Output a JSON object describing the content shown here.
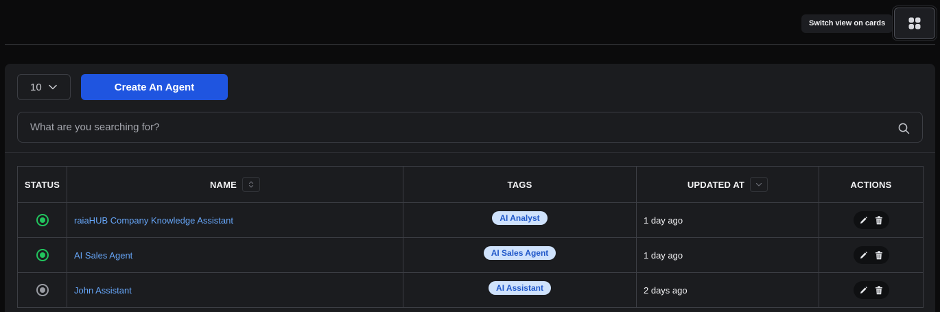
{
  "header": {
    "tooltip_text": "Switch view on cards",
    "switch_icon": "grid-icon"
  },
  "toolbar": {
    "page_size": "10",
    "create_label": "Create An Agent",
    "accent_color": "#1f55e0"
  },
  "search": {
    "placeholder": "What are you searching for?",
    "value": ""
  },
  "table": {
    "columns": {
      "status": "STATUS",
      "name": "NAME",
      "tags": "TAGS",
      "updated_at": "UPDATED AT",
      "actions": "ACTIONS"
    },
    "rows": [
      {
        "status": "active",
        "name": "raiaHUB Company Knowledge Assistant",
        "tag": "AI Analyst",
        "updated": "1 day ago"
      },
      {
        "status": "active",
        "name": "AI Sales Agent",
        "tag": "AI Sales Agent",
        "updated": "1 day ago"
      },
      {
        "status": "inactive",
        "name": "John Assistant",
        "tag": "AI Assistant",
        "updated": "2 days ago"
      }
    ]
  },
  "colors": {
    "status_active": "#22c55e",
    "status_inactive": "#9a9ca3",
    "link": "#66a5f7",
    "tag_bg": "#cfe2fc",
    "tag_text": "#1f57c9"
  }
}
